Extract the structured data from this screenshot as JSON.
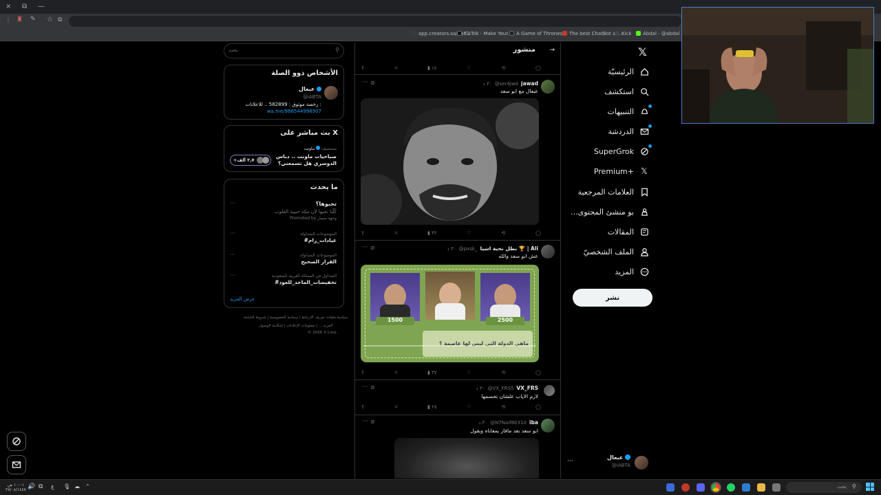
{
  "window": {
    "close": "×",
    "restore": "⧉",
    "minimize": "—"
  },
  "bookmarks": [
    {
      "label": "app.creators.sa/das...",
      "color": "#3b3b3b"
    },
    {
      "label": "TikTok - Make Your...",
      "color": "#111111"
    },
    {
      "label": "A Game of Thrones...",
      "color": "#222222"
    },
    {
      "label": "The best ChatBot an...",
      "color": "#c0392b"
    },
    {
      "label": "Kick",
      "color": "#53fc18"
    },
    {
      "label": "Abdal - @abdal | ...",
      "color": "#444444"
    }
  ],
  "nav": {
    "items": [
      {
        "label": "الرئيسيّة",
        "icon": "home-icon"
      },
      {
        "label": "استكشف",
        "icon": "search-icon"
      },
      {
        "label": "التنبيهات",
        "icon": "bell-icon"
      },
      {
        "label": "الدردشة",
        "icon": "mail-icon"
      },
      {
        "label": "SuperGrok",
        "icon": "grok-icon"
      },
      {
        "label": "Premium+",
        "icon": "x-icon"
      },
      {
        "label": "العلامات المرجعية",
        "icon": "bookmark-icon"
      },
      {
        "label": "...بو منشئ المحتوى",
        "icon": "creator-icon"
      },
      {
        "label": "المقالات",
        "icon": "articles-icon"
      },
      {
        "label": "الملف الشخصيّ",
        "icon": "profile-icon"
      },
      {
        "label": "المزيد",
        "icon": "more-icon"
      }
    ],
    "post_button": "نشر",
    "profile": {
      "name": "عبعال",
      "handle": "@iABTA"
    }
  },
  "feed": {
    "title": "منشور",
    "top_actions": {
      "views": "١٤"
    },
    "posts": [
      {
        "name": "jawad",
        "handle": "@ser4jwd",
        "time": "٣٠ د",
        "text": "عبعال مع ابو سعد",
        "views": "٣٢"
      },
      {
        "name": "بطل نخبة اسيا 🏆 | Ali",
        "handle": "@pxsk_",
        "time": "٣٠ د",
        "text": "عش ابو سعد والله",
        "views": "٣٧",
        "image": {
          "scores": [
            "1500",
            "2500"
          ],
          "question": "ماهي الدولة التي ليس لها عاصمة ؟"
        }
      },
      {
        "name": "VX_FRS",
        "handle": "@VX_FRS5",
        "time": "٣٠ د",
        "text": "لازم الاياب علشان تحسمها",
        "views": "٢٥"
      },
      {
        "name": "iba",
        "handle": "@N7Naif80310",
        "time": "٣٠ د",
        "text": "ابو سعد بعد مافاز بمعاناه وبقول"
      }
    ]
  },
  "sidebar": {
    "search_placeholder": "بحث",
    "relevant": {
      "title": "الأشخاص ذوو الصلة",
      "name": "عبعال",
      "handle": "@iABTA",
      "bio": "رخصة موثوق : 582899 .. للاعلانات :",
      "link": "wa.me/966544998907"
    },
    "live": {
      "title": "بث مباشر على X",
      "host": "ماونت",
      "host_prefix": "يستضيف",
      "text_line1": "صباحيات ماونت .. دباس",
      "text_line2": "الدوسري هل تسمعني؟",
      "listeners": "+٢٫٧ ألف"
    },
    "trends": {
      "title": "ما يحدث",
      "items": [
        {
          "category": "",
          "name": "تحبوها؟",
          "sub": "كُلّنا نحبها لأن مكة حبيبة القلوب",
          "promoted": "Promoted by وجهة مسار"
        },
        {
          "category": "الموضوعات المتداولة",
          "name": "#عيادات_رام",
          "sub": "",
          "promoted": ""
        },
        {
          "category": "الموضوعات المتداولة",
          "name": "القرار الصحيح",
          "sub": "",
          "promoted": ""
        },
        {
          "category": "المتداول في المملكة العربية السعودية",
          "name": "#تخفيضات_الماجد_للعود",
          "sub": "",
          "promoted": ""
        }
      ],
      "show_more": "عرض المزيد"
    },
    "footer": {
      "line1": [
        "شروط الخدمة",
        "سياسة الخصوصية",
        "سياسة ملفات تعريف الارتباط"
      ],
      "line2": [
        "إمكانية الوصول",
        "معلومات الإعلانات",
        "المزيد ..."
      ],
      "copyright": "© 2026 X Corp."
    }
  },
  "taskbar": {
    "search_placeholder": "بحث",
    "time": "١٠:٠١ ص",
    "date": "٢٧/٠٨/١٤٤٧"
  },
  "colors": {
    "accent": "#1d9bf0",
    "border": "#2f3336",
    "muted": "#71767b"
  }
}
